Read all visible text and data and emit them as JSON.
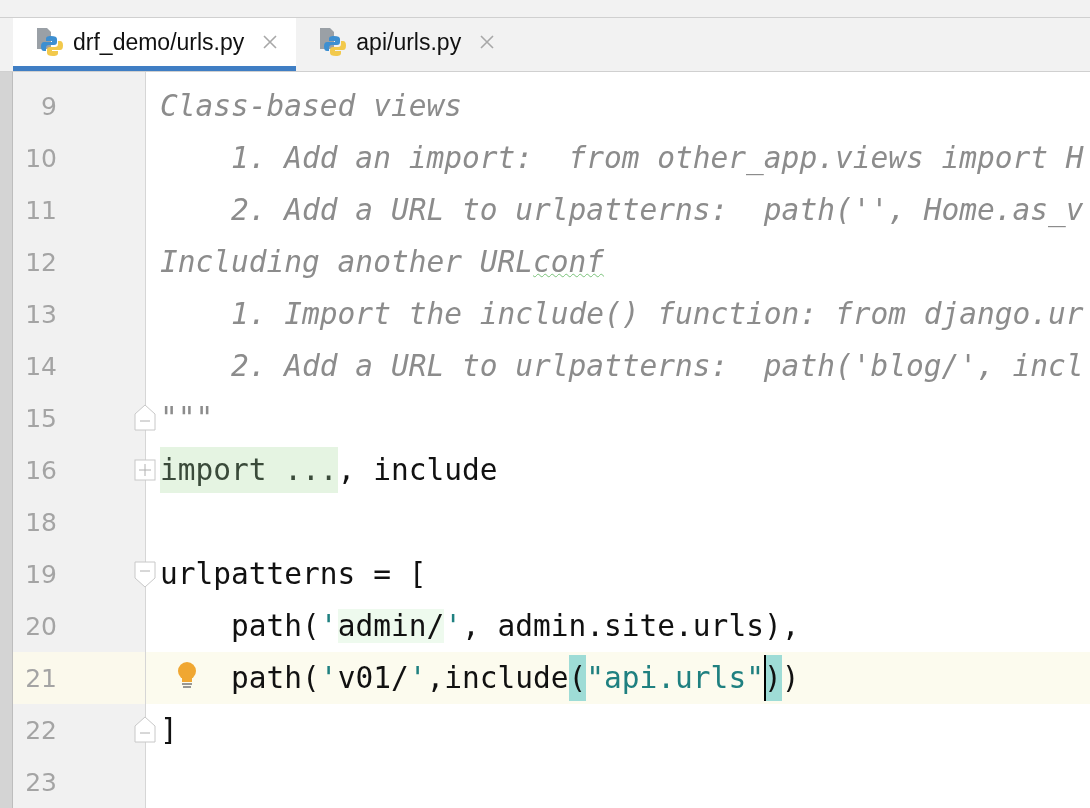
{
  "tabs": [
    {
      "label": "drf_demo/urls.py",
      "selected": true
    },
    {
      "label": "api/urls.py",
      "selected": false
    }
  ],
  "editor": {
    "lines": [
      {
        "number": "9",
        "tokens": [
          {
            "text": "Class-based views",
            "kind": "comment"
          }
        ]
      },
      {
        "number": "10",
        "tokens": [
          {
            "text": "    1. Add an import:  from other_app.views import H",
            "kind": "comment"
          }
        ]
      },
      {
        "number": "11",
        "tokens": [
          {
            "text": "    2. Add a URL to urlpatterns:  path('', Home.as_v",
            "kind": "comment"
          }
        ]
      },
      {
        "number": "12",
        "tokens": [
          {
            "text": "Including another URL",
            "kind": "comment"
          },
          {
            "text": "conf",
            "kind": "typo"
          }
        ]
      },
      {
        "number": "13",
        "tokens": [
          {
            "text": "    1. Import the include() function: from django.ur",
            "kind": "comment"
          }
        ]
      },
      {
        "number": "14",
        "tokens": [
          {
            "text": "    2. Add a URL to urlpatterns:  path('blog/', incl",
            "kind": "comment"
          }
        ]
      },
      {
        "number": "15",
        "fold_end": true,
        "tokens": [
          {
            "text": "\"\"\"",
            "kind": "comment"
          }
        ]
      },
      {
        "number": "16",
        "foldable": true,
        "expanded": false,
        "tokens": [
          {
            "text": "import ...",
            "kind": "folded"
          },
          {
            "text": ", include",
            "kind": "plain"
          }
        ]
      },
      {
        "number": "18"
      },
      {
        "number": "19",
        "foldable": true,
        "expanded": true,
        "tokens": [
          {
            "text": "urlpatterns = [",
            "kind": "plain"
          }
        ]
      },
      {
        "number": "20",
        "tokens": [
          {
            "text": "    path(",
            "kind": "plain"
          },
          {
            "text": "'",
            "kind": "quote"
          },
          {
            "text": "admin/",
            "kind": "injected"
          },
          {
            "text": "'",
            "kind": "quote"
          },
          {
            "text": ", admin.site.urls),",
            "kind": "plain"
          }
        ]
      },
      {
        "number": "21",
        "current": true,
        "bulb": true,
        "tokens": [
          {
            "text": "    path(",
            "kind": "plain"
          },
          {
            "text": "'",
            "kind": "quote"
          },
          {
            "text": "v01/",
            "kind": "plain"
          },
          {
            "text": "'",
            "kind": "quote"
          },
          {
            "text": ",include",
            "kind": "plain"
          },
          {
            "text": "(",
            "kind": "brace"
          },
          {
            "text": "\"api.urls\"",
            "kind": "string"
          },
          {
            "text": ")",
            "kind": "brace",
            "caret": true
          },
          {
            "text": ")",
            "kind": "plain"
          }
        ]
      },
      {
        "number": "22",
        "fold_end": true,
        "tokens": [
          {
            "text": "]",
            "kind": "plain"
          }
        ]
      },
      {
        "number": "23"
      }
    ]
  }
}
